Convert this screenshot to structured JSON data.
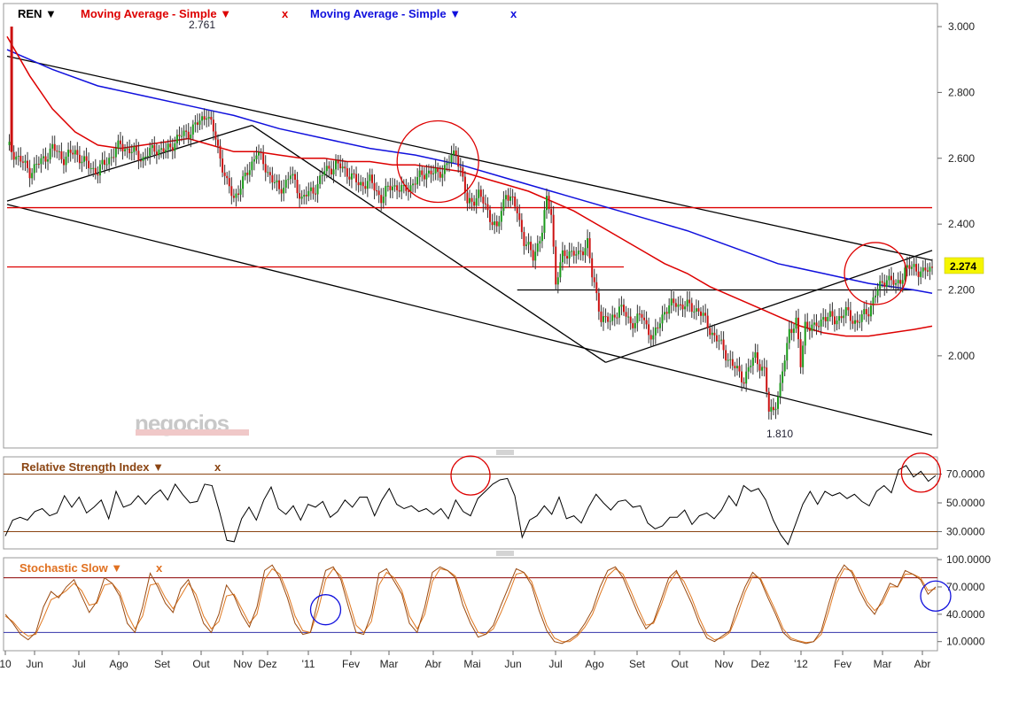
{
  "chart_data": [
    {
      "type": "candlestick",
      "symbol": "REN",
      "legend": [
        {
          "name": "REN",
          "color": "#000000",
          "arrow": "▼"
        },
        {
          "name": "Moving Average - Simple",
          "color": "#dd0000",
          "arrow": "▼",
          "close": "x"
        },
        {
          "name": "Moving Average - Simple",
          "color": "#1010dd",
          "arrow": "▼",
          "close": "x"
        }
      ],
      "yticks": [
        "3.000",
        "2.800",
        "2.600",
        "2.400",
        "2.200",
        "2.000"
      ],
      "ylim": [
        1.72,
        3.07
      ],
      "last_price": "2.274",
      "high_label": "2.761",
      "low_label": "1.810",
      "watermark": "negocios",
      "price_path": [
        [
          0,
          2.64
        ],
        [
          5,
          2.6
        ],
        [
          10,
          2.56
        ],
        [
          15,
          2.59
        ],
        [
          20,
          2.63
        ],
        [
          25,
          2.6
        ],
        [
          30,
          2.62
        ],
        [
          35,
          2.58
        ],
        [
          40,
          2.56
        ],
        [
          45,
          2.6
        ],
        [
          50,
          2.64
        ],
        [
          55,
          2.62
        ],
        [
          60,
          2.6
        ],
        [
          65,
          2.63
        ],
        [
          70,
          2.62
        ],
        [
          75,
          2.66
        ],
        [
          80,
          2.68
        ],
        [
          85,
          2.71
        ],
        [
          88,
          2.74
        ],
        [
          92,
          2.66
        ],
        [
          97,
          2.52
        ],
        [
          100,
          2.48
        ],
        [
          105,
          2.54
        ],
        [
          110,
          2.62
        ],
        [
          115,
          2.56
        ],
        [
          120,
          2.5
        ],
        [
          125,
          2.55
        ],
        [
          130,
          2.48
        ],
        [
          135,
          2.5
        ],
        [
          140,
          2.56
        ],
        [
          145,
          2.58
        ],
        [
          150,
          2.56
        ],
        [
          155,
          2.52
        ],
        [
          160,
          2.53
        ],
        [
          165,
          2.48
        ],
        [
          170,
          2.52
        ],
        [
          175,
          2.5
        ],
        [
          180,
          2.53
        ],
        [
          185,
          2.56
        ],
        [
          190,
          2.55
        ],
        [
          195,
          2.59
        ],
        [
          198,
          2.62
        ],
        [
          200,
          2.57
        ],
        [
          203,
          2.46
        ],
        [
          208,
          2.49
        ],
        [
          212,
          2.44
        ],
        [
          216,
          2.38
        ],
        [
          220,
          2.5
        ],
        [
          225,
          2.44
        ],
        [
          228,
          2.35
        ],
        [
          232,
          2.3
        ],
        [
          236,
          2.38
        ],
        [
          238,
          2.47
        ],
        [
          240,
          2.44
        ],
        [
          242,
          2.22
        ],
        [
          245,
          2.3
        ],
        [
          248,
          2.32
        ],
        [
          252,
          2.3
        ],
        [
          256,
          2.35
        ],
        [
          258,
          2.24
        ],
        [
          262,
          2.12
        ],
        [
          266,
          2.1
        ],
        [
          270,
          2.15
        ],
        [
          275,
          2.1
        ],
        [
          280,
          2.12
        ],
        [
          285,
          2.05
        ],
        [
          290,
          2.14
        ],
        [
          295,
          2.16
        ],
        [
          300,
          2.15
        ],
        [
          305,
          2.14
        ],
        [
          310,
          2.08
        ],
        [
          315,
          2.03
        ],
        [
          320,
          1.97
        ],
        [
          325,
          1.93
        ],
        [
          330,
          2.0
        ],
        [
          334,
          1.95
        ],
        [
          336,
          1.83
        ],
        [
          338,
          1.84
        ],
        [
          341,
          1.9
        ],
        [
          345,
          2.08
        ],
        [
          348,
          2.1
        ],
        [
          350,
          1.97
        ],
        [
          352,
          2.1
        ],
        [
          356,
          2.08
        ],
        [
          360,
          2.12
        ],
        [
          365,
          2.11
        ],
        [
          370,
          2.13
        ],
        [
          375,
          2.1
        ],
        [
          380,
          2.14
        ],
        [
          384,
          2.2
        ],
        [
          388,
          2.24
        ],
        [
          392,
          2.21
        ],
        [
          396,
          2.26
        ],
        [
          400,
          2.27
        ],
        [
          404,
          2.25
        ],
        [
          408,
          2.27
        ]
      ],
      "ma_red": [
        [
          0,
          2.97
        ],
        [
          10,
          2.85
        ],
        [
          20,
          2.75
        ],
        [
          30,
          2.68
        ],
        [
          40,
          2.64
        ],
        [
          50,
          2.63
        ],
        [
          60,
          2.64
        ],
        [
          70,
          2.65
        ],
        [
          80,
          2.66
        ],
        [
          90,
          2.64
        ],
        [
          100,
          2.62
        ],
        [
          110,
          2.62
        ],
        [
          120,
          2.61
        ],
        [
          130,
          2.6
        ],
        [
          140,
          2.6
        ],
        [
          150,
          2.59
        ],
        [
          160,
          2.59
        ],
        [
          170,
          2.58
        ],
        [
          180,
          2.58
        ],
        [
          190,
          2.57
        ],
        [
          200,
          2.56
        ],
        [
          210,
          2.54
        ],
        [
          220,
          2.52
        ],
        [
          230,
          2.5
        ],
        [
          240,
          2.47
        ],
        [
          250,
          2.44
        ],
        [
          260,
          2.4
        ],
        [
          270,
          2.36
        ],
        [
          280,
          2.32
        ],
        [
          290,
          2.28
        ],
        [
          300,
          2.25
        ],
        [
          310,
          2.21
        ],
        [
          320,
          2.18
        ],
        [
          330,
          2.15
        ],
        [
          340,
          2.12
        ],
        [
          350,
          2.09
        ],
        [
          360,
          2.07
        ],
        [
          370,
          2.06
        ],
        [
          380,
          2.06
        ],
        [
          390,
          2.07
        ],
        [
          400,
          2.08
        ],
        [
          408,
          2.09
        ]
      ],
      "ma_blue": [
        [
          0,
          2.93
        ],
        [
          20,
          2.87
        ],
        [
          40,
          2.82
        ],
        [
          60,
          2.79
        ],
        [
          80,
          2.76
        ],
        [
          100,
          2.73
        ],
        [
          120,
          2.69
        ],
        [
          140,
          2.66
        ],
        [
          160,
          2.63
        ],
        [
          180,
          2.61
        ],
        [
          200,
          2.58
        ],
        [
          220,
          2.54
        ],
        [
          240,
          2.5
        ],
        [
          260,
          2.46
        ],
        [
          280,
          2.42
        ],
        [
          300,
          2.38
        ],
        [
          320,
          2.33
        ],
        [
          340,
          2.28
        ],
        [
          360,
          2.25
        ],
        [
          380,
          2.22
        ],
        [
          400,
          2.2
        ],
        [
          408,
          2.19
        ]
      ],
      "trendlines": [
        {
          "color": "#000000",
          "from": [
            0,
            2.91
          ],
          "to": [
            408,
            2.29
          ]
        },
        {
          "color": "#000000",
          "from": [
            0,
            2.46
          ],
          "to": [
            408,
            1.76
          ]
        },
        {
          "color": "#000000",
          "from": [
            0,
            2.47
          ],
          "to": [
            108,
            2.7
          ]
        },
        {
          "color": "#000000",
          "from": [
            108,
            2.7
          ],
          "to": [
            264,
            1.98
          ]
        },
        {
          "color": "#000000",
          "from": [
            264,
            1.98
          ],
          "to": [
            408,
            2.32
          ]
        },
        {
          "color": "#000000",
          "from": [
            225,
            2.2
          ],
          "to": [
            400,
            2.2
          ]
        },
        {
          "color": "#dd0000",
          "from": [
            0,
            2.45
          ],
          "to": [
            408,
            2.45
          ]
        },
        {
          "color": "#dd0000",
          "from": [
            0,
            2.27
          ],
          "to": [
            272,
            2.27
          ]
        }
      ],
      "circles": [
        {
          "color": "#dd0000",
          "x": 190,
          "y": 2.59,
          "r": 46
        },
        {
          "color": "#dd0000",
          "x": 383,
          "y": 2.25,
          "r": 35
        }
      ]
    },
    {
      "type": "line",
      "title": "Relative Strength Index",
      "close": "x",
      "yticks": [
        "70.0000",
        "50.0000",
        "30.0000"
      ],
      "ylim": [
        18,
        82
      ],
      "levels": [
        70,
        30
      ],
      "values": [
        27,
        38,
        40,
        38,
        44,
        46,
        41,
        43,
        55,
        47,
        54,
        43,
        47,
        52,
        39,
        58,
        47,
        49,
        55,
        49,
        55,
        59,
        52,
        63,
        56,
        50,
        51,
        63,
        62,
        44,
        24,
        23,
        39,
        47,
        38,
        52,
        61,
        46,
        42,
        48,
        38,
        49,
        47,
        51,
        40,
        44,
        52,
        47,
        54,
        54,
        41,
        52,
        60,
        49,
        46,
        48,
        44,
        46,
        42,
        46,
        39,
        52,
        44,
        41,
        53,
        58,
        63,
        66,
        67,
        55,
        26,
        38,
        41,
        48,
        42,
        54,
        39,
        41,
        36,
        47,
        56,
        50,
        45,
        51,
        52,
        47,
        48,
        36,
        32,
        34,
        40,
        40,
        45,
        35,
        41,
        43,
        39,
        45,
        55,
        48,
        62,
        58,
        60,
        52,
        38,
        28,
        21,
        35,
        49,
        58,
        49,
        58,
        55,
        57,
        53,
        56,
        51,
        48,
        58,
        62,
        57,
        73,
        76,
        68,
        72,
        65,
        69
      ],
      "circles": [
        {
          "color": "#dd0000",
          "i": 63,
          "v": 69,
          "r": 22
        },
        {
          "color": "#dd0000",
          "i": 124,
          "v": 71,
          "r": 22
        }
      ]
    },
    {
      "type": "line",
      "title": "Stochastic Slow",
      "close": "x",
      "yticks": [
        "100.0000",
        "70.0000",
        "40.0000",
        "10.0000"
      ],
      "ylim": [
        0,
        102
      ],
      "levels": [
        80,
        20
      ],
      "k": [
        40,
        30,
        18,
        12,
        20,
        48,
        65,
        58,
        70,
        78,
        60,
        42,
        54,
        80,
        74,
        60,
        30,
        20,
        48,
        85,
        70,
        52,
        42,
        68,
        78,
        55,
        30,
        20,
        40,
        72,
        60,
        40,
        26,
        48,
        88,
        94,
        80,
        58,
        30,
        18,
        20,
        55,
        88,
        92,
        78,
        48,
        20,
        18,
        40,
        85,
        90,
        76,
        62,
        30,
        20,
        48,
        86,
        92,
        88,
        80,
        50,
        30,
        15,
        18,
        28,
        50,
        70,
        90,
        86,
        72,
        44,
        22,
        10,
        8,
        12,
        18,
        30,
        45,
        70,
        88,
        92,
        80,
        60,
        40,
        24,
        32,
        56,
        80,
        88,
        70,
        52,
        30,
        14,
        10,
        16,
        22,
        48,
        70,
        86,
        78,
        58,
        40,
        20,
        12,
        10,
        8,
        10,
        22,
        52,
        80,
        94,
        86,
        66,
        50,
        40,
        56,
        74,
        70,
        88,
        84,
        78,
        62,
        70
      ],
      "d": [
        38,
        32,
        22,
        16,
        18,
        36,
        56,
        60,
        66,
        74,
        66,
        50,
        52,
        72,
        74,
        64,
        40,
        24,
        38,
        72,
        74,
        58,
        46,
        60,
        74,
        62,
        38,
        24,
        32,
        60,
        62,
        46,
        30,
        40,
        78,
        90,
        84,
        64,
        38,
        22,
        20,
        44,
        78,
        90,
        82,
        56,
        28,
        20,
        32,
        72,
        86,
        80,
        66,
        38,
        24,
        40,
        76,
        90,
        88,
        82,
        58,
        36,
        20,
        18,
        24,
        42,
        62,
        84,
        86,
        76,
        52,
        28,
        14,
        10,
        10,
        16,
        26,
        40,
        62,
        82,
        90,
        84,
        66,
        46,
        28,
        30,
        50,
        74,
        86,
        76,
        58,
        36,
        18,
        12,
        14,
        20,
        40,
        64,
        82,
        80,
        62,
        44,
        24,
        14,
        11,
        9,
        10,
        18,
        44,
        74,
        90,
        88,
        72,
        54,
        44,
        52,
        70,
        70,
        84,
        84,
        80,
        66,
        68
      ],
      "circles": [
        {
          "color": "#1010dd",
          "i": 42,
          "v": 45,
          "r": 17
        },
        {
          "color": "#1010dd",
          "i": 122,
          "v": 60,
          "r": 17
        }
      ]
    },
    {
      "type": "axis",
      "xticks": [
        "10",
        "Jun",
        "Jul",
        "Ago",
        "Set",
        "Out",
        "Nov",
        "Dez",
        "'11",
        "Fev",
        "Mar",
        "Abr",
        "Mai",
        "Jun",
        "Jul",
        "Ago",
        "Set",
        "Out",
        "Nov",
        "Dez",
        "'12",
        "Fev",
        "Mar",
        "Abr"
      ]
    }
  ]
}
